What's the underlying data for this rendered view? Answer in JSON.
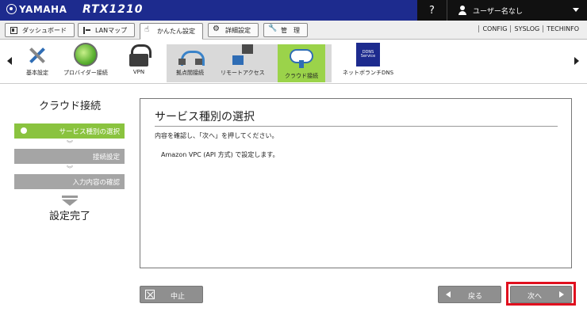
{
  "header": {
    "brand": "YAMAHA",
    "model": "RTX1210",
    "help_label": "?",
    "user_label": "ユーザー名なし",
    "colors": {
      "bar": "#1d2b8e",
      "user_area": "#111111"
    }
  },
  "tabs": [
    {
      "label": "ダッシュボード",
      "icon": "dashboard-icon"
    },
    {
      "label": "LANマップ",
      "icon": "lan-map-icon"
    },
    {
      "label": "かんたん設定",
      "icon": "hand-icon",
      "active": true
    },
    {
      "label": "詳細設定",
      "icon": "gear-icon"
    },
    {
      "label": "管　理",
      "icon": "wrench-icon"
    }
  ],
  "links": [
    "CONFIG",
    "SYSLOG",
    "TECHINFO"
  ],
  "icon_strip": {
    "items": [
      {
        "label": "基本設定",
        "icon": "tools-icon"
      },
      {
        "label": "プロバイダー接続",
        "icon": "globe-icon"
      },
      {
        "label": "VPN",
        "icon": "lock-icon"
      },
      {
        "label": "拠点間接続",
        "icon": "site-connection-icon"
      },
      {
        "label": "リモートアクセス",
        "icon": "remote-access-icon"
      },
      {
        "label": "クラウド接続",
        "icon": "cloud-icon",
        "active": true
      },
      {
        "label": "ネットボランチDNS",
        "icon": "ddns-icon",
        "badge_lines": [
          "DDNS",
          "Service"
        ]
      }
    ],
    "active_color": "#9bd34a"
  },
  "wizard": {
    "title": "クラウド接続",
    "steps": [
      {
        "label": "サービス種別の選択",
        "current": true
      },
      {
        "label": "接続設定"
      },
      {
        "label": "入力内容の確認"
      }
    ],
    "done_label": "設定完了",
    "current_color": "#8ac33f"
  },
  "panel": {
    "title": "サービス種別の選択",
    "instruction": "内容を確認し、「次へ」を押してください。",
    "body": "Amazon VPC (API 方式) で設定します。"
  },
  "buttons": {
    "cancel": "中止",
    "back": "戻る",
    "next": "次へ",
    "highlight_color": "#e0101e"
  }
}
